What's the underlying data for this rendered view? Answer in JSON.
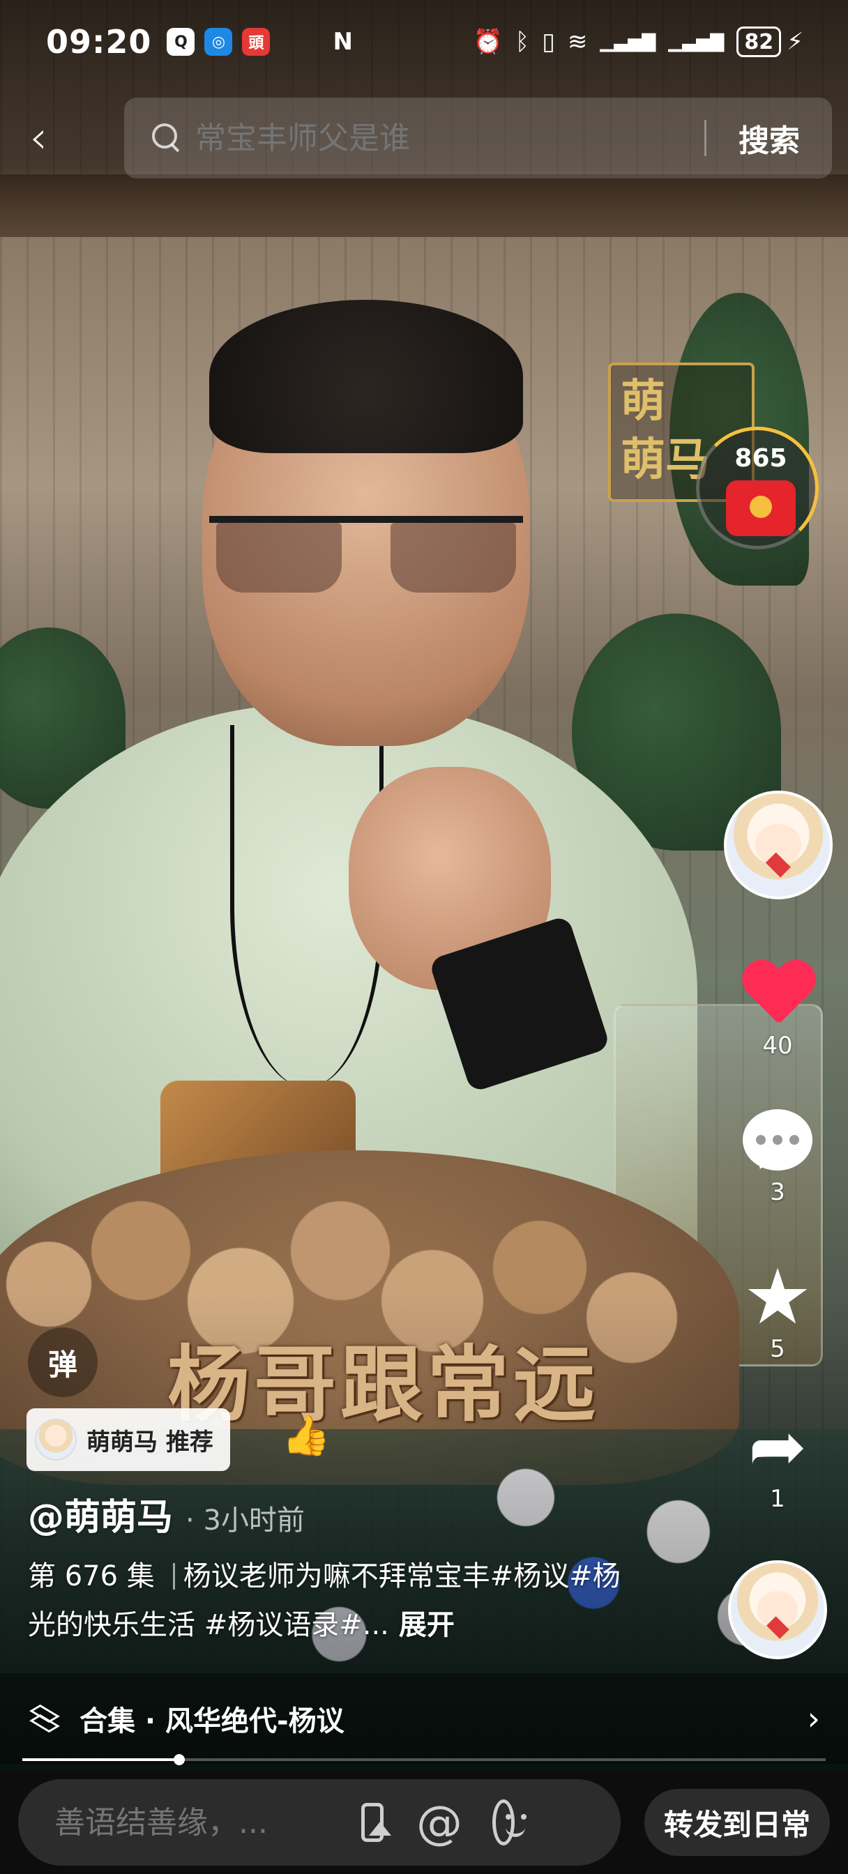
{
  "status_bar": {
    "time": "09:20",
    "apps": [
      {
        "icon": "qq-icon",
        "glyph": "Q",
        "color": "#1f1f1f",
        "bg": "#ffffff"
      },
      {
        "icon": "browser-icon",
        "glyph": "◎",
        "color": "#ffffff",
        "bg": "#1e88e5"
      },
      {
        "icon": "news-icon",
        "glyph": "頭",
        "color": "#ffffff",
        "bg": "#e53935"
      }
    ],
    "nfc": "N",
    "alarm": "⏰",
    "bluetooth": "ᛒ",
    "vibrate": "▯",
    "wifi": "≋",
    "signal1": "▁▃▅▇",
    "signal2": "▁▃▅▇",
    "battery": "82",
    "charging": "⚡"
  },
  "search": {
    "back": "‹",
    "placeholder": "常宝丰师父是谁",
    "button": "搜索"
  },
  "video": {
    "watermark": "萌\n萌马",
    "caption": "杨哥跟常远"
  },
  "actions": {
    "red_packet_count": "865",
    "likes": "40",
    "comments": "3",
    "favorites": "5",
    "shares": "1",
    "like_color": "#fe2c55"
  },
  "info": {
    "danmu": "弹",
    "recommend": "萌萌马 推荐",
    "thumb": "👍",
    "author": "@萌萌马",
    "time": "· 3小时前",
    "episode": "第 676 集",
    "description": "杨议老师为嘛不拜常宝丰#杨议#杨光的快乐生活 #杨议语录#...",
    "expand": "展开"
  },
  "collection": {
    "label": "合集 · 风华绝代-杨议",
    "chevron": "›"
  },
  "progress": {
    "fraction": 0.195
  },
  "comment_bar": {
    "placeholder": "善语结善缘，...",
    "at": "@",
    "forward": "转发到日常"
  }
}
